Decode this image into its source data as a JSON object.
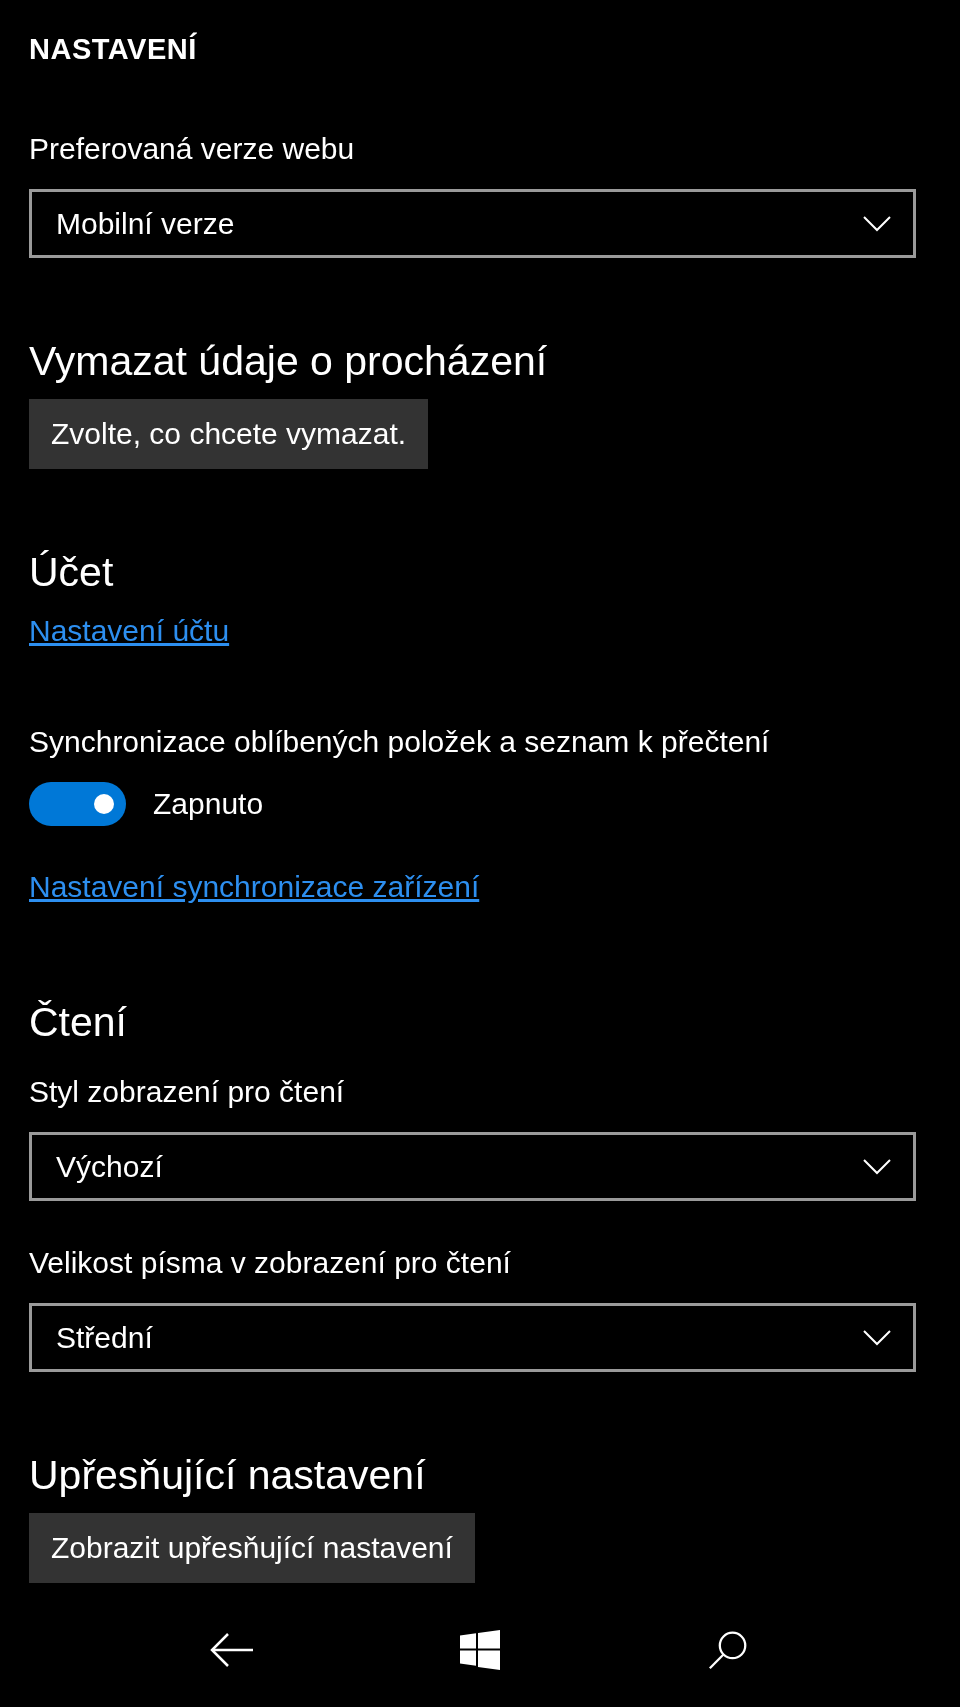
{
  "title": "NASTAVENÍ",
  "sections": [
    {
      "items": [
        {
          "kind": "label",
          "text": "Preferovaná verze webu"
        },
        {
          "kind": "dropdown",
          "value": "Mobilní verze"
        }
      ]
    },
    {
      "heading": "Vymazat údaje o procházení",
      "items": [
        {
          "kind": "button",
          "text": "Zvolte, co chcete vymazat."
        }
      ]
    },
    {
      "heading": "Účet",
      "items": [
        {
          "kind": "link",
          "text": "Nastavení účtu"
        }
      ]
    },
    {
      "items": [
        {
          "kind": "label",
          "text": "Synchronizace oblíbených položek a seznam k přečtení"
        },
        {
          "kind": "toggle",
          "on": true,
          "text": "Zapnuto"
        },
        {
          "kind": "link",
          "text": "Nastavení synchronizace zařízení"
        }
      ]
    },
    {
      "heading": "Čtení",
      "items": [
        {
          "kind": "label",
          "text": "Styl zobrazení pro čtení"
        },
        {
          "kind": "dropdown",
          "value": "Výchozí"
        },
        {
          "kind": "label",
          "text": "Velikost písma v zobrazení pro čtení"
        },
        {
          "kind": "dropdown",
          "value": "Střední"
        }
      ]
    },
    {
      "heading": "Upřesňující nastavení",
      "items": [
        {
          "kind": "button",
          "text": "Zobrazit upřesňující nastavení"
        }
      ]
    }
  ]
}
